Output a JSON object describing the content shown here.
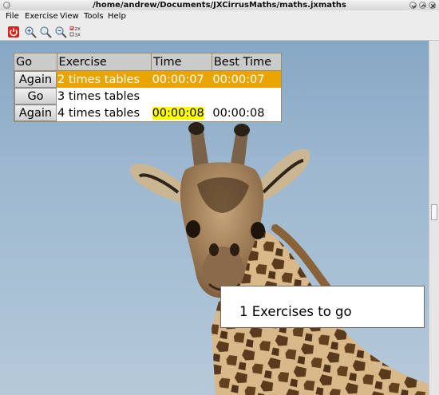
{
  "window": {
    "title": "/home/andrew/Documents/JXCirrusMaths/maths.jxmaths"
  },
  "menu": {
    "items": [
      "File",
      "Exercise",
      "View",
      "Tools",
      "Help"
    ]
  },
  "toolbar": {
    "icons": [
      "power-icon",
      "zoom-in-icon",
      "zoom-reset-icon",
      "zoom-out-icon",
      "multiplication-table-icon"
    ],
    "table_icon_lines": [
      "2X",
      "3X"
    ]
  },
  "table": {
    "headers": [
      "Go",
      "Exercise",
      "Time",
      "Best Time"
    ],
    "rows": [
      {
        "button": "Again",
        "exercise": "2 times tables",
        "time": "00:00:07",
        "best": "00:00:07",
        "selected": true
      },
      {
        "button": "Go",
        "exercise": "3 times tables",
        "time": "",
        "best": "",
        "selected": false
      },
      {
        "button": "Again",
        "exercise": "4 times tables",
        "time": "00:00:08",
        "best": "00:00:08",
        "selected": false,
        "time_highlight": true
      }
    ]
  },
  "status": {
    "text": "1 Exercises to go"
  },
  "background_image": {
    "subject": "giraffe"
  },
  "colors": {
    "selected_row": "#e9a400",
    "time_highlight": "#ffff00",
    "power_button": "#d8251c"
  }
}
